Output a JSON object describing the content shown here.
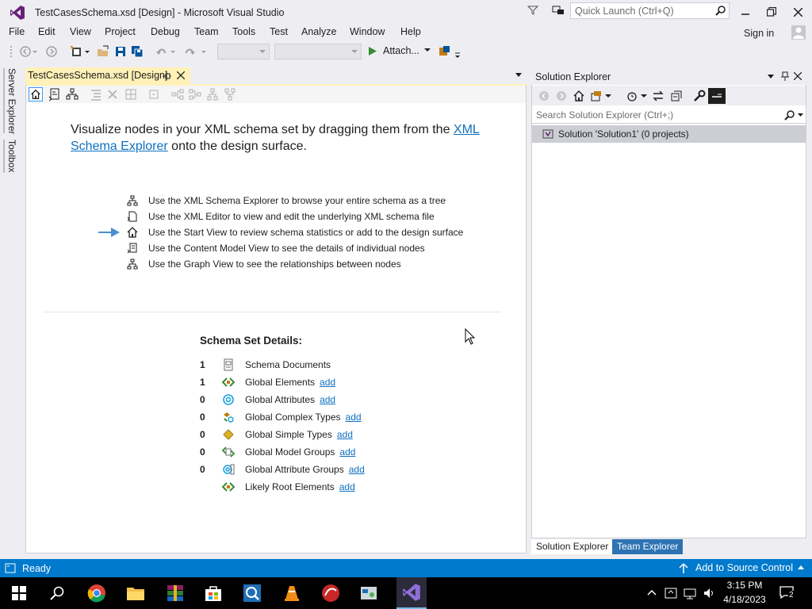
{
  "window": {
    "title": "TestCasesSchema.xsd [Design] - Microsoft Visual Studio",
    "quick_launch_placeholder": "Quick Launch (Ctrl+Q)",
    "sign_in": "Sign in"
  },
  "menu": [
    "File",
    "Edit",
    "View",
    "Project",
    "Debug",
    "Team",
    "Tools",
    "Test",
    "Analyze",
    "Window",
    "Help"
  ],
  "toolbar": {
    "attach_label": "Attach...",
    "solution_config": "",
    "solution_platform": ""
  },
  "left_strip": {
    "server_explorer": "Server Explorer",
    "toolbox": "Toolbox"
  },
  "document": {
    "tab_label": "TestCasesSchema.xsd [Design]",
    "intro_before": "Visualize nodes in your XML schema set by dragging them from the ",
    "intro_link": "XML Schema Explorer",
    "intro_after": " onto the design surface.",
    "tips": [
      {
        "icon": "tree-icon",
        "text": "Use the XML Schema Explorer to browse your entire schema as a tree"
      },
      {
        "icon": "xml-editor-icon",
        "text": "Use the XML Editor to view and edit the underlying XML schema file"
      },
      {
        "icon": "home-icon",
        "text": "Use the Start View to review schema statistics or add to the design surface"
      },
      {
        "icon": "content-model-icon",
        "text": "Use the Content Model View to see the details of individual nodes"
      },
      {
        "icon": "graph-icon",
        "text": "Use the Graph View to see the relationships between nodes"
      }
    ],
    "details_title": "Schema Set Details:",
    "details": [
      {
        "count": "1",
        "icon": "schema-documents-icon",
        "label": "Schema Documents",
        "link": ""
      },
      {
        "count": "1",
        "icon": "global-element-icon",
        "label": "Global Elements",
        "link": "add"
      },
      {
        "count": "0",
        "icon": "global-attribute-icon",
        "label": "Global Attributes",
        "link": "add"
      },
      {
        "count": "0",
        "icon": "complex-type-icon",
        "label": "Global Complex Types",
        "link": "add"
      },
      {
        "count": "0",
        "icon": "simple-type-icon",
        "label": "Global Simple Types",
        "link": "add"
      },
      {
        "count": "0",
        "icon": "model-group-icon",
        "label": "Global Model Groups",
        "link": "add"
      },
      {
        "count": "0",
        "icon": "attribute-group-icon",
        "label": "Global Attribute Groups",
        "link": "add"
      },
      {
        "count": "",
        "icon": "root-element-icon",
        "label": "Likely Root Elements",
        "link": "add"
      }
    ]
  },
  "solution_explorer": {
    "title": "Solution Explorer",
    "search_placeholder": "Search Solution Explorer (Ctrl+;)",
    "solution_label": "Solution 'Solution1' (0 projects)",
    "tabs": [
      "Solution Explorer",
      "Team Explorer"
    ]
  },
  "statusbar": {
    "status": "Ready",
    "source_control": "Add to Source Control"
  },
  "taskbar": {
    "time": "3:15 PM",
    "date": "4/18/2023",
    "notification_count": "2"
  },
  "colors": {
    "accent": "#007acc",
    "link": "#0e70c0",
    "tab_active": "#fff1b8"
  }
}
